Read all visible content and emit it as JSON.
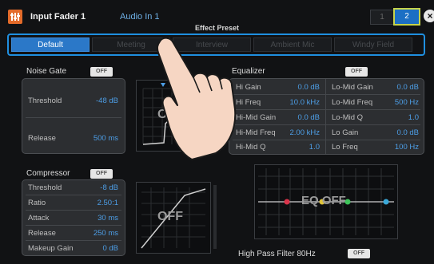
{
  "header": {
    "title": "Input Fader 1",
    "subtitle": "Audio In 1",
    "page1": "1",
    "page2": "2",
    "close": "×"
  },
  "preset": {
    "title": "Effect Preset",
    "tabs": [
      "Default",
      "Meeting",
      "Interview",
      "Ambient Mic",
      "Windy Field"
    ]
  },
  "noise_gate": {
    "label": "Noise Gate",
    "toggle": "OFF",
    "threshold_label": "Threshold",
    "threshold_value": "-48 dB",
    "release_label": "Release",
    "release_value": "500 ms",
    "graph_label": "OFF"
  },
  "compressor": {
    "label": "Compressor",
    "toggle": "OFF",
    "rows": [
      {
        "label": "Threshold",
        "value": "-8 dB"
      },
      {
        "label": "Ratio",
        "value": "2.50:1"
      },
      {
        "label": "Attack",
        "value": "30 ms"
      },
      {
        "label": "Release",
        "value": "250 ms"
      },
      {
        "label": "Makeup Gain",
        "value": "0 dB"
      }
    ],
    "graph_label": "OFF"
  },
  "equalizer": {
    "label": "Equalizer",
    "toggle": "OFF",
    "left": [
      {
        "label": "Hi Gain",
        "value": "0.0 dB"
      },
      {
        "label": "Hi Freq",
        "value": "10.0 kHz"
      },
      {
        "label": "Hi-Mid Gain",
        "value": "0.0 dB"
      },
      {
        "label": "Hi-Mid Freq",
        "value": "2.00 kHz"
      },
      {
        "label": "Hi-Mid Q",
        "value": "1.0"
      }
    ],
    "right": [
      {
        "label": "Lo-Mid Gain",
        "value": "0.0 dB"
      },
      {
        "label": "Lo-Mid Freq",
        "value": "500 Hz"
      },
      {
        "label": "Lo-Mid Q",
        "value": "1.0"
      },
      {
        "label": "Lo Gain",
        "value": "0.0 dB"
      },
      {
        "label": "Lo Freq",
        "value": "100 Hz"
      }
    ],
    "graph_label": "EQ OFF"
  },
  "hpf": {
    "label": "High Pass Filter 80Hz",
    "toggle": "OFF"
  },
  "colors": {
    "accent": "#1f8fe0",
    "value": "#4d9ee6",
    "selected_tab": "#2b78c8"
  }
}
